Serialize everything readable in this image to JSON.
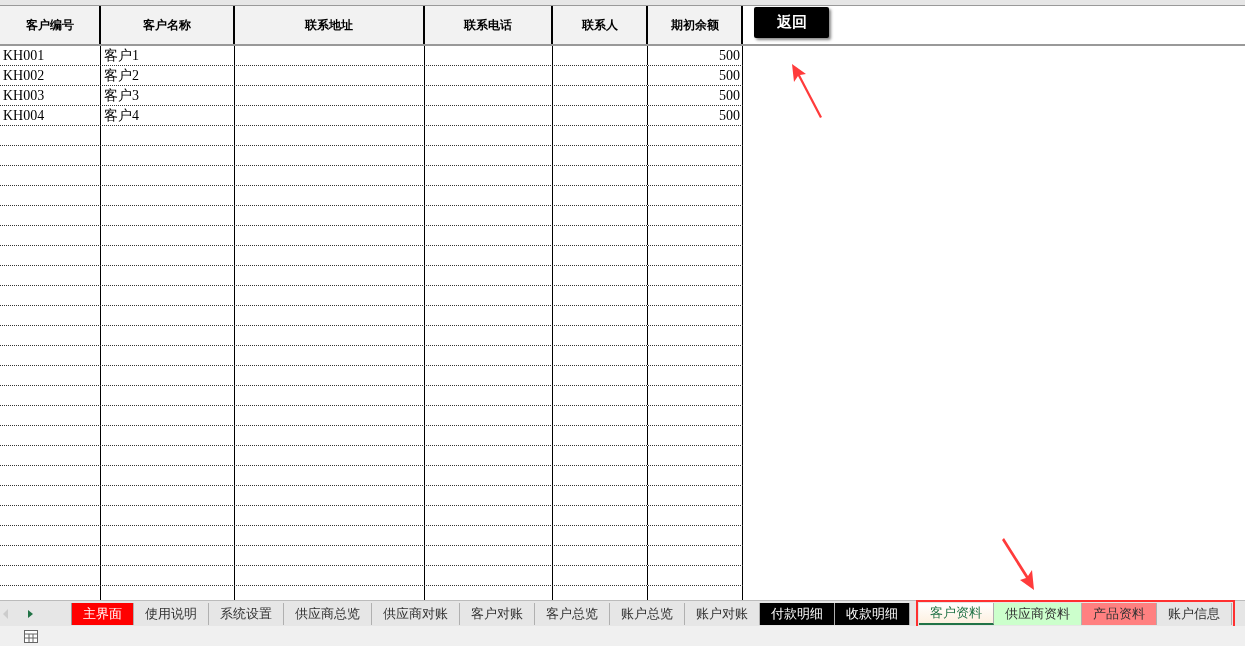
{
  "table": {
    "columns": [
      "客户编号",
      "客户名称",
      "联系地址",
      "联系电话",
      "联系人",
      "期初余额"
    ],
    "rows": [
      {
        "id": "KH001",
        "name": "客户1",
        "balance": "500"
      },
      {
        "id": "KH002",
        "name": "客户2",
        "balance": "500"
      },
      {
        "id": "KH003",
        "name": "客户3",
        "balance": "500"
      },
      {
        "id": "KH004",
        "name": "客户4",
        "balance": "500"
      }
    ]
  },
  "back_button": "返回",
  "sheet_tabs": [
    {
      "label": "主界面",
      "color": "#ff0000",
      "selected": false,
      "highlighted": false
    },
    {
      "label": "使用说明",
      "color": "#e6e6e6",
      "selected": false,
      "highlighted": false
    },
    {
      "label": "系统设置",
      "color": "#e6e6e6",
      "selected": false,
      "highlighted": false
    },
    {
      "label": "供应商总览",
      "color": "#e6e6e6",
      "selected": false,
      "highlighted": false
    },
    {
      "label": "供应商对账",
      "color": "#e6e6e6",
      "selected": false,
      "highlighted": false
    },
    {
      "label": "客户对账",
      "color": "#e6e6e6",
      "selected": false,
      "highlighted": false
    },
    {
      "label": "客户总览",
      "color": "#e6e6e6",
      "selected": false,
      "highlighted": false
    },
    {
      "label": "账户总览",
      "color": "#e6e6e6",
      "selected": false,
      "highlighted": false
    },
    {
      "label": "账户对账",
      "color": "#e6e6e6",
      "selected": false,
      "highlighted": false
    },
    {
      "label": "付款明细",
      "color": "#000000",
      "selected": false,
      "highlighted": false
    },
    {
      "label": "收款明细",
      "color": "#000000",
      "selected": false,
      "highlighted": false
    },
    {
      "label": "客户资料",
      "color": "#fdf0e0",
      "selected": true,
      "highlighted": true
    },
    {
      "label": "供应商资料",
      "color": "#ccffcc",
      "selected": false,
      "highlighted": true
    },
    {
      "label": "产品资料",
      "color": "#ff8080",
      "selected": false,
      "highlighted": true
    },
    {
      "label": "账户信息",
      "color": "#e6e6e6",
      "selected": false,
      "highlighted": true
    }
  ]
}
